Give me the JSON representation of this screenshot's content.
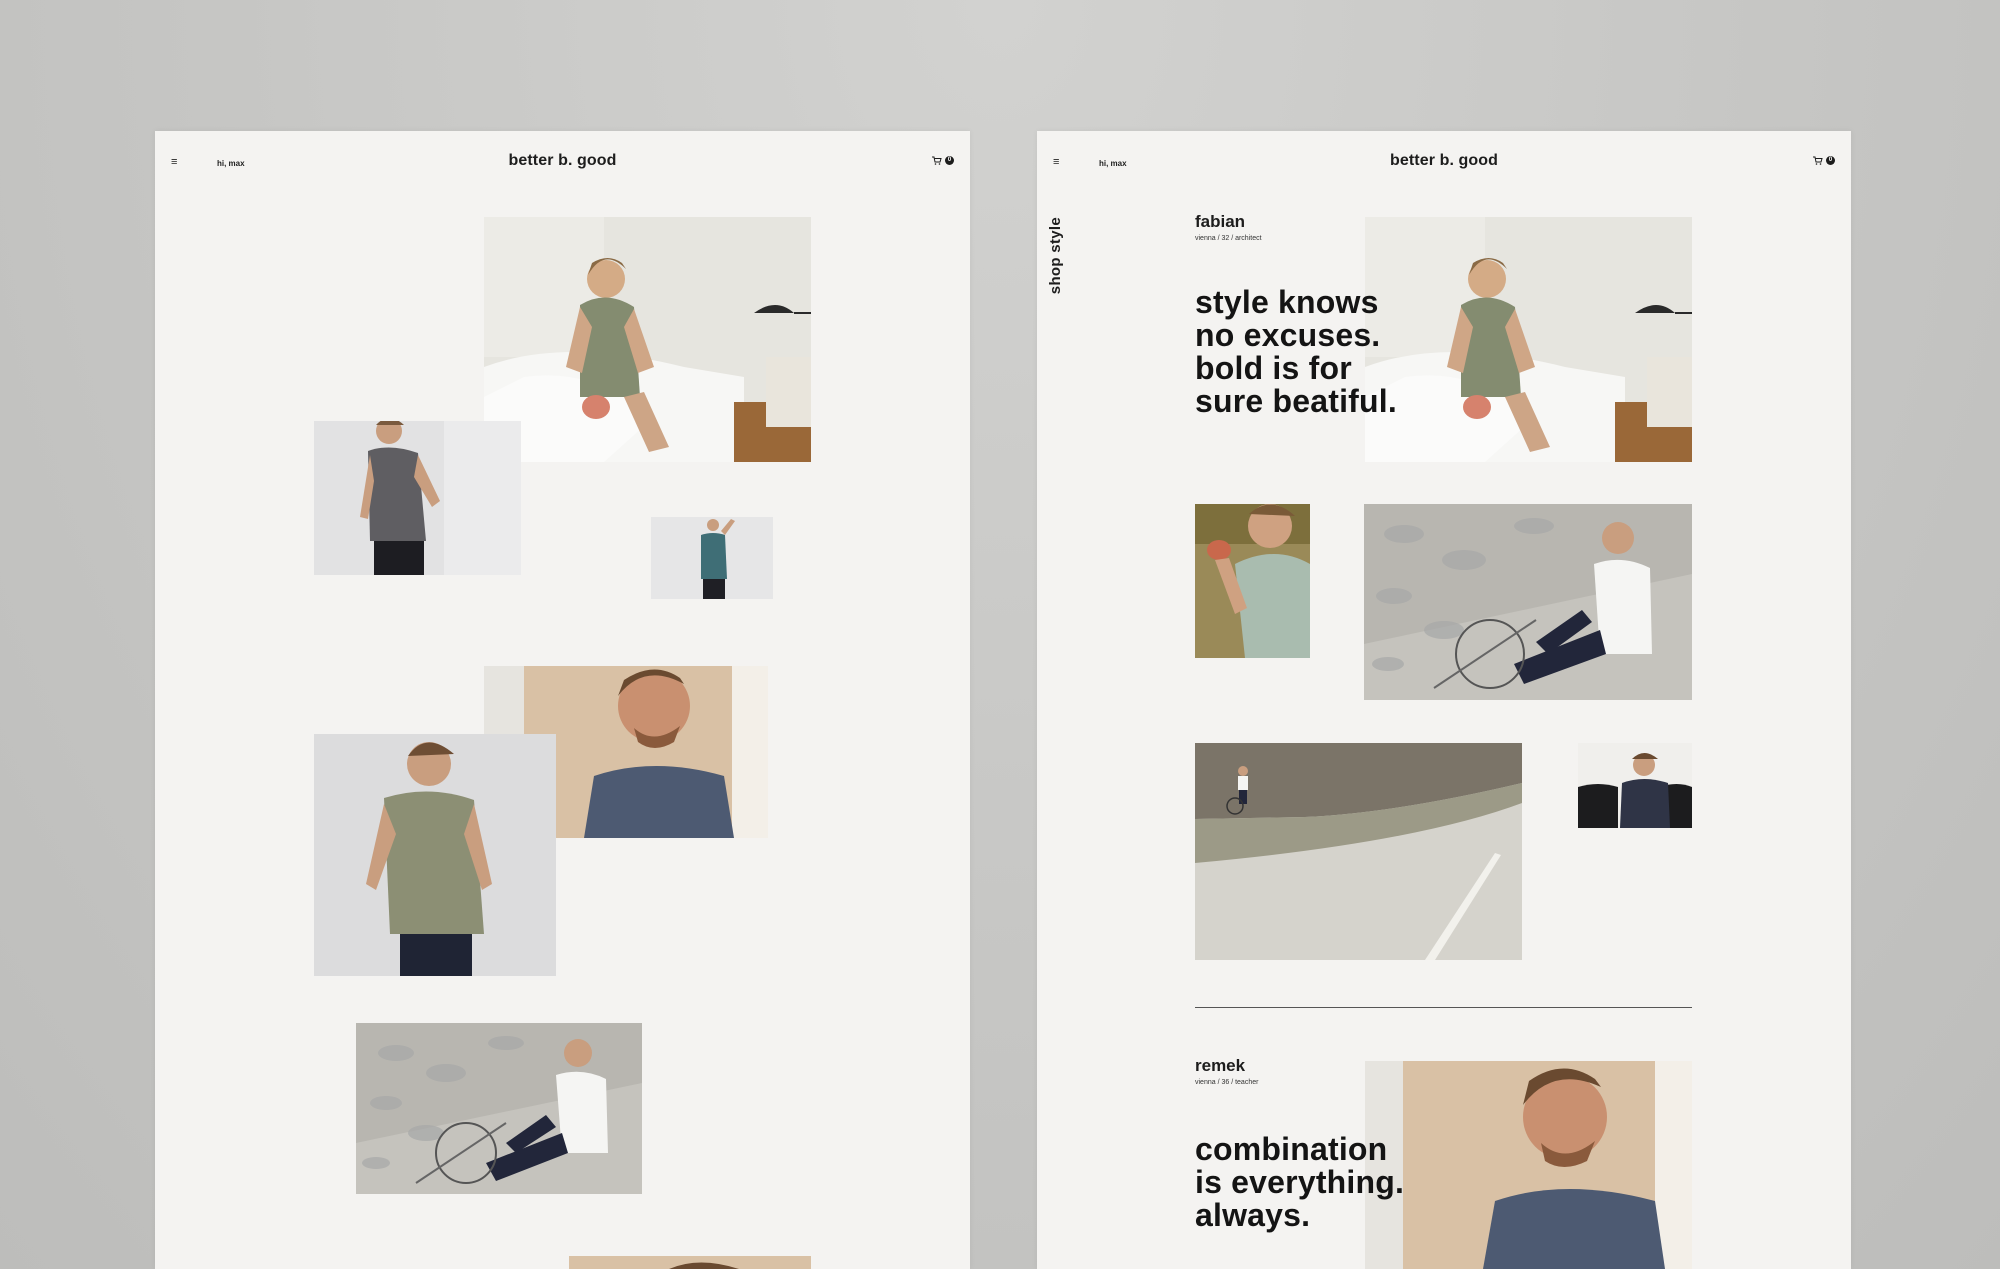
{
  "left_page": {
    "header": {
      "menu_icon": "≡",
      "greeting": "hi, max",
      "brand": "better b. good",
      "cart_count": "0"
    }
  },
  "right_page": {
    "header": {
      "menu_icon": "≡",
      "greeting": "hi, max",
      "brand": "better b. good",
      "cart_count": "0"
    },
    "side_link": "shop style",
    "profiles": [
      {
        "name": "fabian",
        "meta": "vienna / 32 / architect",
        "quote": "style knows\nno excuses.\nbold is for\nsure beatiful."
      },
      {
        "name": "remek",
        "meta": "vienna / 36 / teacher",
        "quote": "combination\nis everything.\nalways."
      }
    ]
  },
  "colors": {
    "page_background": "#f4f3f1",
    "outer_background": "#c6c6c4",
    "text": "#1d1d1d"
  }
}
